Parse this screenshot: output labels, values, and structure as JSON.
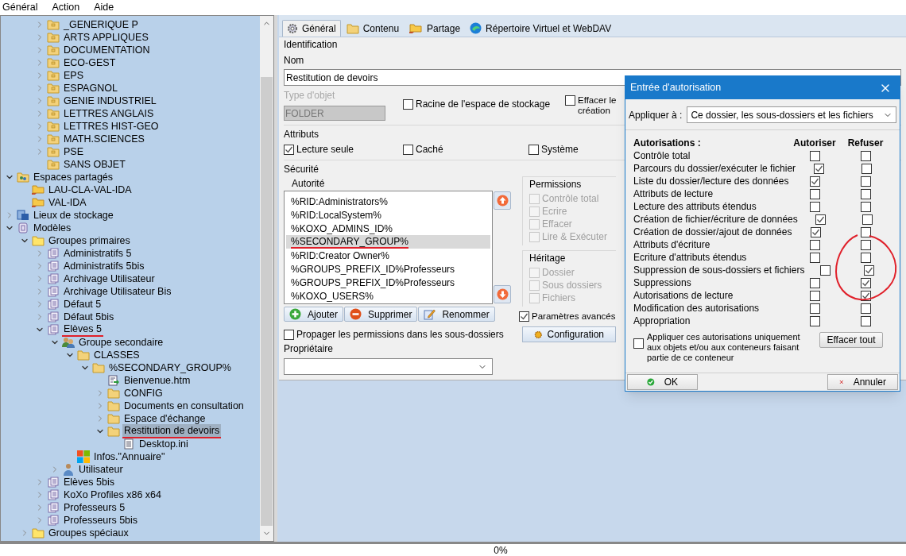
{
  "menu": [
    "Général",
    "Action",
    "Aide"
  ],
  "tree_scrolled": [
    {
      "label": "_GENERIQUE P",
      "kind": "folder-doc",
      "expanded": false,
      "selected": false
    },
    {
      "label": "ARTS APPLIQUES",
      "kind": "folder-doc",
      "expanded": false,
      "selected": false
    },
    {
      "label": "DOCUMENTATION",
      "kind": "folder-doc",
      "expanded": false,
      "selected": false
    },
    {
      "label": "ECO-GEST",
      "kind": "folder-doc",
      "expanded": false,
      "selected": false
    },
    {
      "label": "EPS",
      "kind": "folder-doc",
      "expanded": false,
      "selected": false
    },
    {
      "label": "ESPAGNOL",
      "kind": "folder-doc",
      "expanded": false,
      "selected": false
    },
    {
      "label": "GENIE INDUSTRIEL",
      "kind": "folder-doc",
      "expanded": false,
      "selected": false
    },
    {
      "label": "LETTRES ANGLAIS",
      "kind": "folder-doc",
      "expanded": false,
      "selected": false
    },
    {
      "label": "LETTRES HIST-GEO",
      "kind": "folder-doc",
      "expanded": false,
      "selected": false
    },
    {
      "label": "MATH.SCIENCES",
      "kind": "folder-doc",
      "expanded": false,
      "selected": false
    },
    {
      "label": "PSE",
      "kind": "folder-doc",
      "expanded": false,
      "selected": false
    },
    {
      "label": "SANS OBJET",
      "kind": "folder-doc",
      "selected": false
    }
  ],
  "tree": [
    {
      "label": "Espaces partagés",
      "kind": "shared",
      "expanded": true,
      "selected": false,
      "children": [
        {
          "label": "LAU-CLA-VAL-IDA",
          "kind": "share",
          "selected": false
        },
        {
          "label": "VAL-IDA",
          "kind": "share",
          "selected": false
        }
      ]
    },
    {
      "label": "Lieux de stockage",
      "kind": "storage",
      "expanded": false,
      "selected": false
    },
    {
      "label": "Modèles",
      "kind": "models",
      "expanded": true,
      "selected": false,
      "children": [
        {
          "label": "Groupes primaires",
          "kind": "folder-open",
          "expanded": true,
          "selected": false,
          "children": [
            {
              "label": "Administratifs 5",
              "kind": "profile",
              "expanded": false,
              "selected": false
            },
            {
              "label": "Administratifs 5bis",
              "kind": "profile",
              "expanded": false,
              "selected": false
            },
            {
              "label": "Archivage Utilisateur",
              "kind": "profile",
              "expanded": false,
              "selected": false
            },
            {
              "label": "Archivage Utilisateur Bis",
              "kind": "profile",
              "expanded": false,
              "selected": false
            },
            {
              "label": "Défaut 5",
              "kind": "profile",
              "expanded": false,
              "selected": false
            },
            {
              "label": "Défaut 5bis",
              "kind": "profile",
              "expanded": false,
              "selected": false
            },
            {
              "label": "Elèves 5",
              "kind": "profile",
              "expanded": true,
              "selected": false,
              "underlined": true,
              "children": [
                {
                  "label": "Groupe secondaire",
                  "kind": "group",
                  "expanded": true,
                  "selected": false,
                  "children": [
                    {
                      "label": "CLASSES",
                      "kind": "folder",
                      "expanded": true,
                      "selected": false,
                      "children": [
                        {
                          "label": "%SECONDARY_GROUP%",
                          "kind": "folder",
                          "expanded": true,
                          "selected": false,
                          "children": [
                            {
                              "label": "Bienvenue.htm",
                              "kind": "file-link",
                              "selected": false
                            },
                            {
                              "label": "CONFIG",
                              "kind": "folder",
                              "expanded": false,
                              "selected": false
                            },
                            {
                              "label": "Documents en consultation",
                              "kind": "folder",
                              "expanded": false,
                              "selected": false
                            },
                            {
                              "label": "Espace d'échange",
                              "kind": "folder",
                              "expanded": false,
                              "selected": false
                            },
                            {
                              "label": "Restitution de devoirs",
                              "kind": "folder",
                              "expanded": true,
                              "selected": true,
                              "underlined": true,
                              "children": [
                                {
                                  "label": "Desktop.ini",
                                  "kind": "file",
                                  "selected": false
                                }
                              ]
                            }
                          ]
                        }
                      ]
                    },
                    {
                      "label": "Infos.\"Annuaire\"",
                      "kind": "tiles",
                      "selected": false
                    }
                  ]
                },
                {
                  "label": "Utilisateur",
                  "kind": "user",
                  "expanded": false,
                  "selected": false
                }
              ]
            },
            {
              "label": "Elèves 5bis",
              "kind": "profile",
              "expanded": false,
              "selected": false
            },
            {
              "label": "KoXo Profiles x86 x64",
              "kind": "profile",
              "expanded": false,
              "selected": false
            },
            {
              "label": "Professeurs 5",
              "kind": "profile",
              "expanded": false,
              "selected": false
            },
            {
              "label": "Professeurs 5bis",
              "kind": "profile",
              "expanded": false,
              "selected": false
            }
          ]
        },
        {
          "label": "Groupes spéciaux",
          "kind": "folder-open",
          "expanded": false,
          "selected": false
        }
      ]
    }
  ],
  "tabs": [
    {
      "label": "Général",
      "kind": "gear",
      "selected": true
    },
    {
      "label": "Contenu",
      "kind": "folder",
      "selected": false
    },
    {
      "label": "Partage",
      "kind": "share",
      "selected": false
    },
    {
      "label": "Répertoire Virtuel et WebDAV",
      "kind": "globe",
      "selected": false
    }
  ],
  "identification": {
    "title": "Identification",
    "name_label": "Nom",
    "name_value": "Restitution de devoirs",
    "type_label": "Type d'objet",
    "type_value": "FOLDER",
    "type_disabled": true,
    "options": [
      {
        "label": "Racine de l'espace de stockage",
        "checked": false
      },
      {
        "label": "Effacer le\ncréation",
        "checked": false
      }
    ]
  },
  "attributes": {
    "title": "Attributs",
    "options": [
      {
        "label": "Lecture seule",
        "checked": true
      },
      {
        "label": "Caché",
        "checked": false
      },
      {
        "label": "Système",
        "checked": false
      }
    ]
  },
  "security": {
    "title": "Sécurité",
    "authority_title": "Autorité",
    "authorities": [
      {
        "label": "%RID:Administrators%",
        "selected": false
      },
      {
        "label": "%RID:LocalSystem%",
        "selected": false
      },
      {
        "label": "%KOXO_ADMINS_ID%",
        "selected": false
      },
      {
        "label": "%SECONDARY_GROUP%",
        "selected": true,
        "underlined": true
      },
      {
        "label": "%RID:Creator Owner%",
        "selected": false
      },
      {
        "label": "%GROUPS_PREFIX_ID%Professeurs",
        "selected": false
      },
      {
        "label": "%GROUPS_PREFIX_ID%Professeurs",
        "selected": false
      },
      {
        "label": "%KOXO_USERS%",
        "selected": false
      }
    ],
    "buttons": [
      {
        "label": "Ajouter",
        "kind": "add"
      },
      {
        "label": "Supprimer",
        "kind": "remove"
      },
      {
        "label": "Renommer",
        "kind": "rename"
      }
    ],
    "permissions_title": "Permissions",
    "permissions": [
      {
        "label": "Contrôle total",
        "checked": false,
        "disabled": true
      },
      {
        "label": "Ecrire",
        "checked": false,
        "disabled": true
      },
      {
        "label": "Effacer",
        "checked": false,
        "disabled": true
      },
      {
        "label": "Lire & Exécuter",
        "checked": false,
        "disabled": true
      }
    ],
    "inheritance_title": "Héritage",
    "inheritance": [
      {
        "label": "Dossier",
        "checked": false,
        "disabled": true
      },
      {
        "label": "Sous dossiers",
        "checked": false,
        "disabled": true
      },
      {
        "label": "Fichiers",
        "checked": false,
        "disabled": true
      }
    ],
    "advanced": {
      "label": "Paramètres avancés",
      "checked": true
    },
    "config_button": "Configuration",
    "propagate": {
      "label": "Propager les permissions dans les sous-dossiers",
      "checked": false
    },
    "owner_label": "Propriétaire"
  },
  "dialog": {
    "title": "Entrée d'autorisation",
    "apply_label": "Appliquer à :",
    "apply_value": "Ce dossier, les sous-dossiers et les fichiers",
    "col_label": "Autorisations :",
    "col_allow": "Autoriser",
    "col_deny": "Refuser",
    "permissions": [
      {
        "label": "Contrôle total",
        "allow": false,
        "deny": false
      },
      {
        "label": "Parcours du dossier/exécuter le fichier",
        "allow": true,
        "deny": false
      },
      {
        "label": "Liste du dossier/lecture des données",
        "allow": true,
        "deny": false
      },
      {
        "label": "Attributs de lecture",
        "allow": false,
        "deny": false
      },
      {
        "label": "Lecture des attributs étendus",
        "allow": false,
        "deny": false
      },
      {
        "label": "Création de fichier/écriture de données",
        "allow": true,
        "deny": false
      },
      {
        "label": "Création de dossier/ajout de données",
        "allow": true,
        "deny": false
      },
      {
        "label": "Attributs d'écriture",
        "allow": false,
        "deny": false
      },
      {
        "label": "Ecriture d'attributs étendus",
        "allow": false,
        "deny": false
      },
      {
        "label": "Suppression de sous-dossiers et fichiers",
        "allow": false,
        "deny": true
      },
      {
        "label": "Suppressions",
        "allow": false,
        "deny": true
      },
      {
        "label": "Autorisations de lecture",
        "allow": false,
        "deny": true
      },
      {
        "label": "Modification des autorisations",
        "allow": false,
        "deny": false
      },
      {
        "label": "Appropriation",
        "allow": false,
        "deny": false
      }
    ],
    "only_this": {
      "label": "Appliquer ces autorisations uniquement aux objets et/ou aux conteneurs faisant partie de ce conteneur",
      "checked": false
    },
    "clear_button": "Effacer tout",
    "ok": "OK",
    "cancel": "Annuler"
  },
  "status": "0%"
}
